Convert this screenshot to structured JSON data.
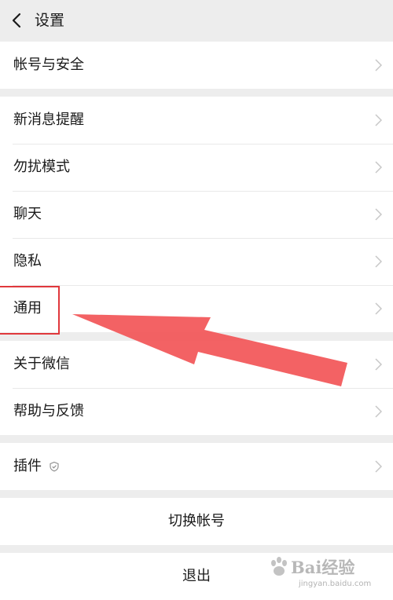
{
  "header": {
    "title": "设置",
    "back_icon": "chevron-left-icon"
  },
  "groups": [
    {
      "items": [
        {
          "label": "帐号与安全"
        }
      ]
    },
    {
      "items": [
        {
          "label": "新消息提醒"
        },
        {
          "label": "勿扰模式"
        },
        {
          "label": "聊天"
        },
        {
          "label": "隐私"
        },
        {
          "label": "通用"
        }
      ]
    },
    {
      "items": [
        {
          "label": "关于微信"
        },
        {
          "label": "帮助与反馈"
        }
      ]
    },
    {
      "items": [
        {
          "label": "插件",
          "badge_icon": "plugin-badge-icon"
        }
      ]
    }
  ],
  "actions": {
    "switch_account": "切换帐号",
    "logout": "退出"
  },
  "annotation": {
    "highlight_color": "#e0383c",
    "arrow_color": "#f25a5c",
    "target": "通用"
  },
  "watermark": {
    "brand": "Bai",
    "brand_suffix": "经验",
    "url": "jingyan.baidu.com"
  },
  "colors": {
    "background": "#ededed",
    "card": "#ffffff",
    "text": "#1a1a1a",
    "chevron": "#c7c7c7"
  }
}
